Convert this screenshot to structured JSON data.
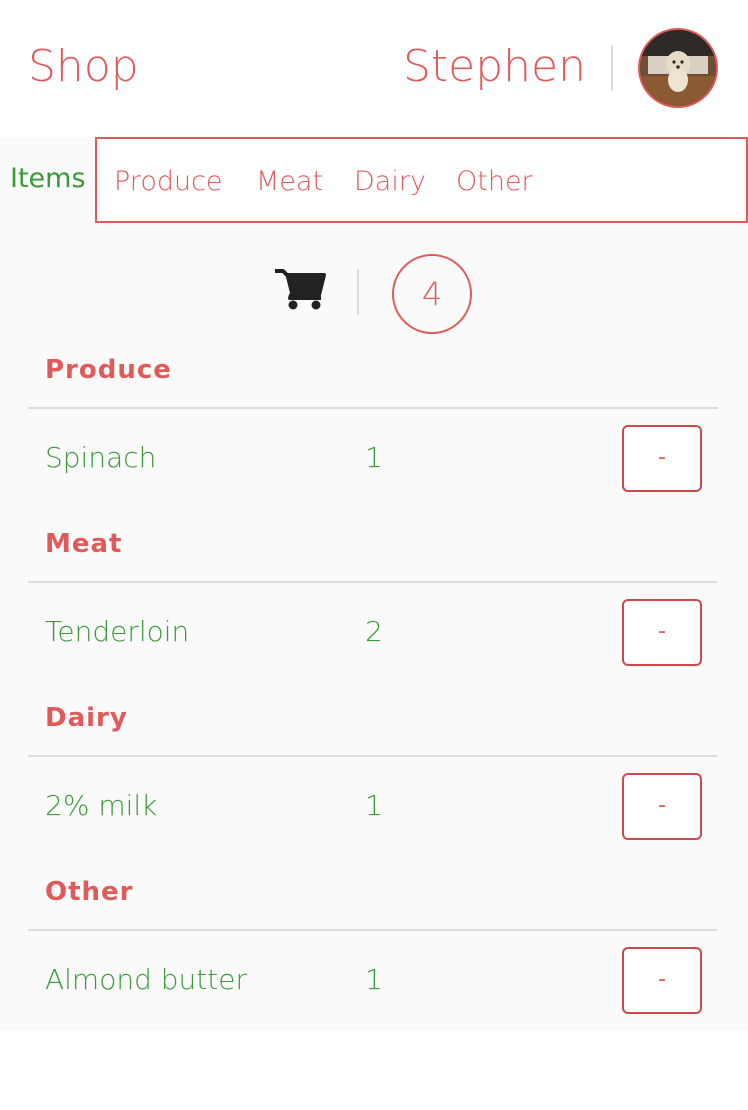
{
  "header": {
    "brand": "Shop",
    "user_name": "Stephen"
  },
  "tabs": {
    "active": "Items",
    "items": [
      "Produce",
      "Meat",
      "Dairy",
      "Other"
    ]
  },
  "cart": {
    "count": "4"
  },
  "sections": [
    {
      "title": "Produce",
      "item": "Spinach",
      "qty": "1",
      "button": "-"
    },
    {
      "title": "Meat",
      "item": "Tenderloin",
      "qty": "2",
      "button": "-"
    },
    {
      "title": "Dairy",
      "item": "2% milk",
      "qty": "1",
      "button": "-"
    },
    {
      "title": "Other",
      "item": "Almond butter",
      "qty": "1",
      "button": "-"
    }
  ],
  "colors": {
    "accent": "#e05a5a",
    "item_text": "#3a9a3a",
    "background": "#fafafa"
  },
  "icons": {
    "cart": "shopping-cart-icon",
    "avatar": "user-avatar"
  }
}
